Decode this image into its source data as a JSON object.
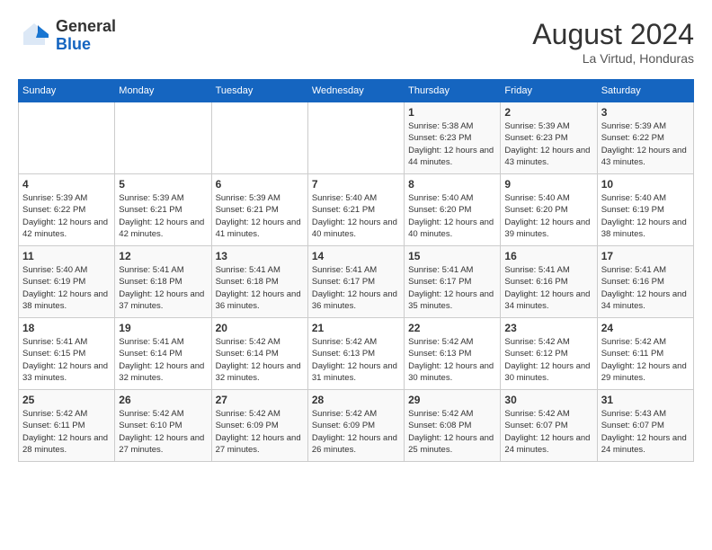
{
  "header": {
    "logo": {
      "general": "General",
      "blue": "Blue"
    },
    "title": "August 2024",
    "location": "La Virtud, Honduras"
  },
  "days_of_week": [
    "Sunday",
    "Monday",
    "Tuesday",
    "Wednesday",
    "Thursday",
    "Friday",
    "Saturday"
  ],
  "weeks": [
    [
      {
        "day": "",
        "content": ""
      },
      {
        "day": "",
        "content": ""
      },
      {
        "day": "",
        "content": ""
      },
      {
        "day": "",
        "content": ""
      },
      {
        "day": "1",
        "content": "Sunrise: 5:38 AM\nSunset: 6:23 PM\nDaylight: 12 hours and 44 minutes."
      },
      {
        "day": "2",
        "content": "Sunrise: 5:39 AM\nSunset: 6:23 PM\nDaylight: 12 hours and 43 minutes."
      },
      {
        "day": "3",
        "content": "Sunrise: 5:39 AM\nSunset: 6:22 PM\nDaylight: 12 hours and 43 minutes."
      }
    ],
    [
      {
        "day": "4",
        "content": "Sunrise: 5:39 AM\nSunset: 6:22 PM\nDaylight: 12 hours and 42 minutes."
      },
      {
        "day": "5",
        "content": "Sunrise: 5:39 AM\nSunset: 6:21 PM\nDaylight: 12 hours and 42 minutes."
      },
      {
        "day": "6",
        "content": "Sunrise: 5:39 AM\nSunset: 6:21 PM\nDaylight: 12 hours and 41 minutes."
      },
      {
        "day": "7",
        "content": "Sunrise: 5:40 AM\nSunset: 6:21 PM\nDaylight: 12 hours and 40 minutes."
      },
      {
        "day": "8",
        "content": "Sunrise: 5:40 AM\nSunset: 6:20 PM\nDaylight: 12 hours and 40 minutes."
      },
      {
        "day": "9",
        "content": "Sunrise: 5:40 AM\nSunset: 6:20 PM\nDaylight: 12 hours and 39 minutes."
      },
      {
        "day": "10",
        "content": "Sunrise: 5:40 AM\nSunset: 6:19 PM\nDaylight: 12 hours and 38 minutes."
      }
    ],
    [
      {
        "day": "11",
        "content": "Sunrise: 5:40 AM\nSunset: 6:19 PM\nDaylight: 12 hours and 38 minutes."
      },
      {
        "day": "12",
        "content": "Sunrise: 5:41 AM\nSunset: 6:18 PM\nDaylight: 12 hours and 37 minutes."
      },
      {
        "day": "13",
        "content": "Sunrise: 5:41 AM\nSunset: 6:18 PM\nDaylight: 12 hours and 36 minutes."
      },
      {
        "day": "14",
        "content": "Sunrise: 5:41 AM\nSunset: 6:17 PM\nDaylight: 12 hours and 36 minutes."
      },
      {
        "day": "15",
        "content": "Sunrise: 5:41 AM\nSunset: 6:17 PM\nDaylight: 12 hours and 35 minutes."
      },
      {
        "day": "16",
        "content": "Sunrise: 5:41 AM\nSunset: 6:16 PM\nDaylight: 12 hours and 34 minutes."
      },
      {
        "day": "17",
        "content": "Sunrise: 5:41 AM\nSunset: 6:16 PM\nDaylight: 12 hours and 34 minutes."
      }
    ],
    [
      {
        "day": "18",
        "content": "Sunrise: 5:41 AM\nSunset: 6:15 PM\nDaylight: 12 hours and 33 minutes."
      },
      {
        "day": "19",
        "content": "Sunrise: 5:41 AM\nSunset: 6:14 PM\nDaylight: 12 hours and 32 minutes."
      },
      {
        "day": "20",
        "content": "Sunrise: 5:42 AM\nSunset: 6:14 PM\nDaylight: 12 hours and 32 minutes."
      },
      {
        "day": "21",
        "content": "Sunrise: 5:42 AM\nSunset: 6:13 PM\nDaylight: 12 hours and 31 minutes."
      },
      {
        "day": "22",
        "content": "Sunrise: 5:42 AM\nSunset: 6:13 PM\nDaylight: 12 hours and 30 minutes."
      },
      {
        "day": "23",
        "content": "Sunrise: 5:42 AM\nSunset: 6:12 PM\nDaylight: 12 hours and 30 minutes."
      },
      {
        "day": "24",
        "content": "Sunrise: 5:42 AM\nSunset: 6:11 PM\nDaylight: 12 hours and 29 minutes."
      }
    ],
    [
      {
        "day": "25",
        "content": "Sunrise: 5:42 AM\nSunset: 6:11 PM\nDaylight: 12 hours and 28 minutes."
      },
      {
        "day": "26",
        "content": "Sunrise: 5:42 AM\nSunset: 6:10 PM\nDaylight: 12 hours and 27 minutes."
      },
      {
        "day": "27",
        "content": "Sunrise: 5:42 AM\nSunset: 6:09 PM\nDaylight: 12 hours and 27 minutes."
      },
      {
        "day": "28",
        "content": "Sunrise: 5:42 AM\nSunset: 6:09 PM\nDaylight: 12 hours and 26 minutes."
      },
      {
        "day": "29",
        "content": "Sunrise: 5:42 AM\nSunset: 6:08 PM\nDaylight: 12 hours and 25 minutes."
      },
      {
        "day": "30",
        "content": "Sunrise: 5:42 AM\nSunset: 6:07 PM\nDaylight: 12 hours and 24 minutes."
      },
      {
        "day": "31",
        "content": "Sunrise: 5:43 AM\nSunset: 6:07 PM\nDaylight: 12 hours and 24 minutes."
      }
    ]
  ]
}
